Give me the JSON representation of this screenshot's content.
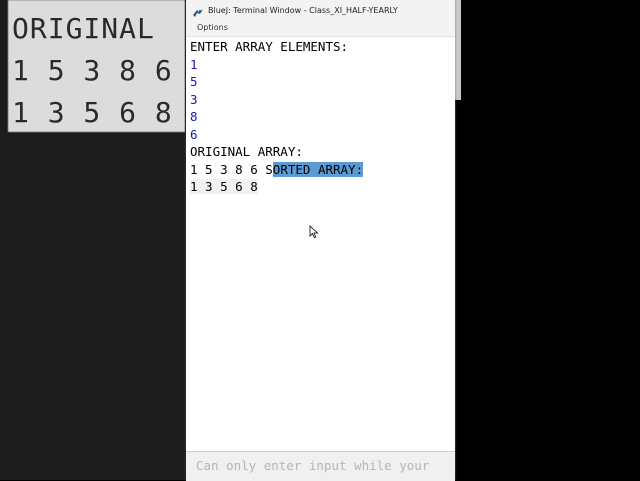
{
  "window": {
    "title": "BlueJ: Terminal Window - Class_XI_HALF-YEARLY",
    "app_icon": "bluej-bird-icon"
  },
  "menu": {
    "options_label": "Options"
  },
  "terminal": {
    "lines": {
      "l0": "ENTER ARRAY ELEMENTS:",
      "l1": "1",
      "l2": "5",
      "l3": "3",
      "l4": "8",
      "l5": "6",
      "l6": "ORIGINAL ARRAY:",
      "l7_plain": "1 5 3 8 6 S",
      "l7_selected": "ORTED ARRAY:",
      "l8": "1 3 5 6 8"
    },
    "input_color": "#1a1ab0",
    "selection_color": "#5b9bd5"
  },
  "status": {
    "hint": "Can only enter input while your"
  },
  "background": {
    "left_lines": [
      "ORIGINAL",
      "1 5 3 8 6",
      "1 3 5 6 8"
    ]
  }
}
